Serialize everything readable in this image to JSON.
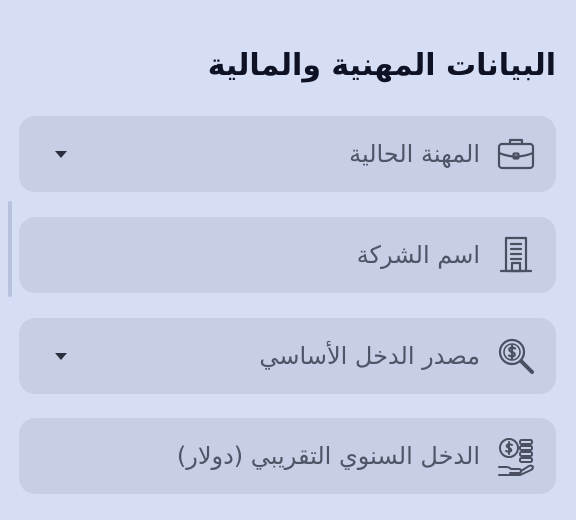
{
  "section": {
    "title": "البيانات المهنية والمالية"
  },
  "fields": [
    {
      "label": "المهنة الحالية",
      "icon": "briefcase-icon",
      "type": "dropdown"
    },
    {
      "label": "اسم الشركة",
      "icon": "building-icon",
      "type": "text"
    },
    {
      "label": "مصدر الدخل الأساسي",
      "icon": "money-search-icon",
      "type": "dropdown"
    },
    {
      "label": "الدخل السنوي التقريبي (دولار)",
      "icon": "money-hand-icon",
      "type": "text"
    }
  ],
  "colors": {
    "background": "#d5def5",
    "field_background": "#c7cfe6",
    "label_text": "#4f5466",
    "title_text": "#0e1224",
    "icon_stroke": "#4a4f61"
  }
}
